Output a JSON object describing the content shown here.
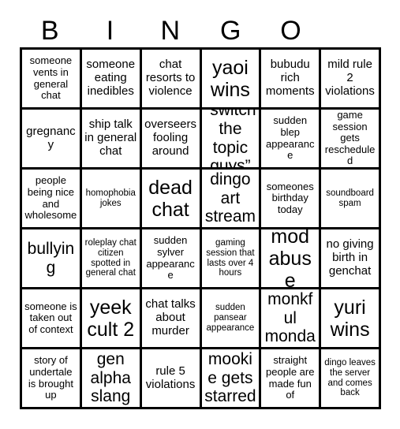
{
  "card": {
    "title": "BINGO",
    "header_letters": [
      "B",
      "I",
      "N",
      "G",
      "O",
      ""
    ],
    "columns": 6,
    "rows": 6,
    "colors": {
      "background": "#ffffff",
      "grid_line": "#000000",
      "text": "#000000"
    },
    "cells": [
      {
        "text": "someone vents in general chat",
        "size": "sm"
      },
      {
        "text": "someone eating inedibles",
        "size": "md"
      },
      {
        "text": "chat resorts to violence",
        "size": "md"
      },
      {
        "text": "yaoi wins",
        "size": "xl"
      },
      {
        "text": "bubudu rich moments",
        "size": "md"
      },
      {
        "text": "mild rule 2 violations",
        "size": "md"
      },
      {
        "text": "gregnancy",
        "size": "md"
      },
      {
        "text": "ship talk in general chat",
        "size": "md"
      },
      {
        "text": "overseers fooling around",
        "size": "md"
      },
      {
        "text": "“switch the topic guys”",
        "size": "lg"
      },
      {
        "text": "sudden blep appearance",
        "size": "sm"
      },
      {
        "text": "game session gets rescheduled",
        "size": "sm"
      },
      {
        "text": "people being nice and wholesome",
        "size": "sm"
      },
      {
        "text": "homophobia jokes",
        "size": "xs"
      },
      {
        "text": "dead chat",
        "size": "xl"
      },
      {
        "text": "dingo art stream",
        "size": "lg"
      },
      {
        "text": "someones birthday today",
        "size": "sm"
      },
      {
        "text": "soundboard spam",
        "size": "xs"
      },
      {
        "text": "bullying",
        "size": "lg"
      },
      {
        "text": "roleplay chat citizen spotted in general chat",
        "size": "xs"
      },
      {
        "text": "sudden sylver appearance",
        "size": "sm"
      },
      {
        "text": "gaming session that lasts over 4 hours",
        "size": "xs"
      },
      {
        "text": "mod abuse",
        "size": "xl"
      },
      {
        "text": "no giving birth in genchat",
        "size": "md"
      },
      {
        "text": "someone is taken out of context",
        "size": "sm"
      },
      {
        "text": "yeek cult 2",
        "size": "xl"
      },
      {
        "text": "chat talks about murder",
        "size": "md"
      },
      {
        "text": "sudden pansear appearance",
        "size": "xs"
      },
      {
        "text": "it’s monkful monday",
        "size": "lg"
      },
      {
        "text": "yuri wins",
        "size": "xl"
      },
      {
        "text": "story of undertale is brought up",
        "size": "sm"
      },
      {
        "text": "gen alpha slang",
        "size": "lg"
      },
      {
        "text": "rule 5 violations",
        "size": "md"
      },
      {
        "text": "mookie gets starred",
        "size": "lg"
      },
      {
        "text": "straight people are made fun of",
        "size": "sm"
      },
      {
        "text": "dingo leaves the server and comes back",
        "size": "xs"
      }
    ]
  }
}
